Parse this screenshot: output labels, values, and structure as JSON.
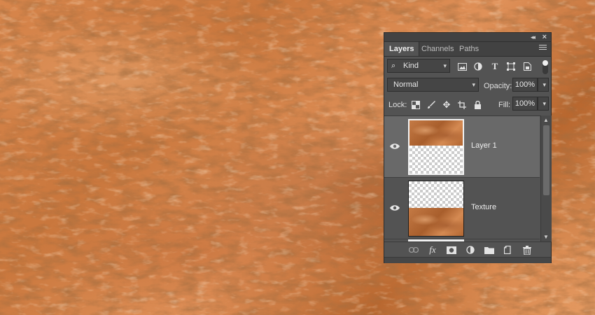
{
  "panel": {
    "tabs": [
      {
        "label": "Layers",
        "active": true
      },
      {
        "label": "Channels",
        "active": false
      },
      {
        "label": "Paths",
        "active": false
      }
    ],
    "filter": {
      "label": "Kind"
    },
    "blend_mode": {
      "value": "Normal"
    },
    "opacity": {
      "label": "Opacity:",
      "value": "100%"
    },
    "lock": {
      "label": "Lock:"
    },
    "fill": {
      "label": "Fill:",
      "value": "100%"
    },
    "layers": [
      {
        "name": "Layer 1",
        "selected": true,
        "visible": true
      },
      {
        "name": "Texture",
        "selected": false,
        "visible": true
      }
    ]
  },
  "colors": {
    "panel_bg": "#535353",
    "selected_row": "#696969",
    "copper": "#c9773d"
  },
  "icons": {
    "filter_types": [
      "image-icon",
      "adjustment-icon",
      "type-icon",
      "shape-icon",
      "smart-object-icon"
    ],
    "lock_types": [
      "lock-pixels-icon",
      "lock-brush-icon",
      "lock-move-icon",
      "lock-artboard-icon",
      "lock-all-icon"
    ],
    "bottom_bar": [
      "link-icon",
      "fx-icon",
      "mask-icon",
      "adjustment-layer-icon",
      "group-folder-icon",
      "new-layer-icon",
      "trash-icon"
    ]
  }
}
